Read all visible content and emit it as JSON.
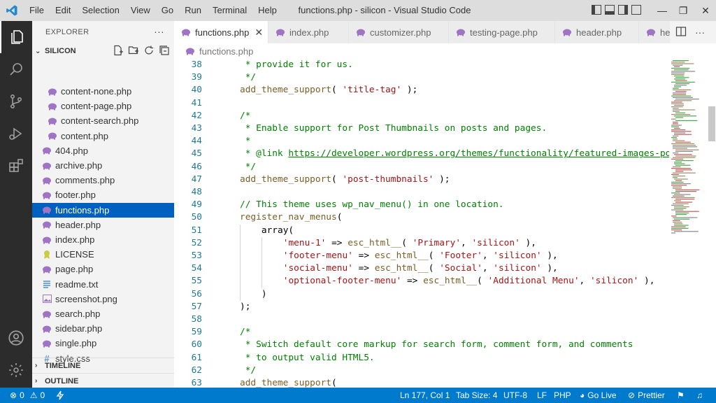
{
  "titlebar": {
    "menu": [
      "File",
      "Edit",
      "Selection",
      "View",
      "Go",
      "Run",
      "Terminal",
      "Help"
    ],
    "window_title": "functions.php - silicon - Visual Studio Code"
  },
  "sidebar": {
    "title": "EXPLORER",
    "more": "···",
    "folder": "SILICON",
    "files": [
      {
        "name": "content-none.php",
        "indent": 2,
        "icon": "php-elephant-icon"
      },
      {
        "name": "content-page.php",
        "indent": 2,
        "icon": "php-elephant-icon"
      },
      {
        "name": "content-search.php",
        "indent": 2,
        "icon": "php-elephant-icon"
      },
      {
        "name": "content.php",
        "indent": 2,
        "icon": "php-elephant-icon"
      },
      {
        "name": "404.php",
        "indent": 1,
        "icon": "php-elephant-icon"
      },
      {
        "name": "archive.php",
        "indent": 1,
        "icon": "php-elephant-icon"
      },
      {
        "name": "comments.php",
        "indent": 1,
        "icon": "php-elephant-icon"
      },
      {
        "name": "footer.php",
        "indent": 1,
        "icon": "php-elephant-icon"
      },
      {
        "name": "functions.php",
        "indent": 1,
        "icon": "php-elephant-icon",
        "active": true
      },
      {
        "name": "header.php",
        "indent": 1,
        "icon": "php-elephant-icon"
      },
      {
        "name": "index.php",
        "indent": 1,
        "icon": "php-elephant-icon"
      },
      {
        "name": "LICENSE",
        "indent": 1,
        "icon": "license-icon"
      },
      {
        "name": "page.php",
        "indent": 1,
        "icon": "php-elephant-icon"
      },
      {
        "name": "readme.txt",
        "indent": 1,
        "icon": "text-file-icon"
      },
      {
        "name": "screenshot.png",
        "indent": 1,
        "icon": "image-file-icon"
      },
      {
        "name": "search.php",
        "indent": 1,
        "icon": "php-elephant-icon"
      },
      {
        "name": "sidebar.php",
        "indent": 1,
        "icon": "php-elephant-icon"
      },
      {
        "name": "single.php",
        "indent": 1,
        "icon": "php-elephant-icon"
      },
      {
        "name": "style.css",
        "indent": 1,
        "icon": "css-hash-icon"
      }
    ],
    "timeline": "TIMELINE",
    "outline": "OUTLINE"
  },
  "tabs": [
    {
      "label": "functions.php",
      "active": true
    },
    {
      "label": "index.php"
    },
    {
      "label": "customizer.php"
    },
    {
      "label": "testing-page.php"
    },
    {
      "label": "header.php"
    },
    {
      "label": "hea"
    }
  ],
  "breadcrumb": "functions.php",
  "editor": {
    "lines": [
      {
        "n": "38",
        "indent": 1,
        "tokens": [
          [
            "comment",
            " * provide it for us."
          ]
        ]
      },
      {
        "n": "39",
        "indent": 1,
        "tokens": [
          [
            "comment",
            " */"
          ]
        ]
      },
      {
        "n": "40",
        "indent": 1,
        "tokens": [
          [
            "fn",
            "add_theme_support"
          ],
          [
            "plain",
            "( "
          ],
          [
            "string",
            "'title-tag'"
          ],
          [
            "plain",
            " );"
          ]
        ]
      },
      {
        "n": "41",
        "indent": 0,
        "tokens": []
      },
      {
        "n": "42",
        "indent": 1,
        "tokens": [
          [
            "comment",
            "/*"
          ]
        ]
      },
      {
        "n": "43",
        "indent": 1,
        "tokens": [
          [
            "comment",
            " * Enable support for Post Thumbnails on posts and pages."
          ]
        ]
      },
      {
        "n": "44",
        "indent": 1,
        "tokens": [
          [
            "comment",
            " *"
          ]
        ]
      },
      {
        "n": "45",
        "indent": 1,
        "tokens": [
          [
            "comment",
            " * @link "
          ],
          [
            "link",
            "https://developer.wordpress.org/themes/functionality/featured-images-post-thumbnails/"
          ]
        ]
      },
      {
        "n": "46",
        "indent": 1,
        "tokens": [
          [
            "comment",
            " */"
          ]
        ]
      },
      {
        "n": "47",
        "indent": 1,
        "tokens": [
          [
            "fn",
            "add_theme_support"
          ],
          [
            "plain",
            "( "
          ],
          [
            "string",
            "'post-thumbnails'"
          ],
          [
            "plain",
            " );"
          ]
        ]
      },
      {
        "n": "48",
        "indent": 0,
        "tokens": []
      },
      {
        "n": "49",
        "indent": 1,
        "tokens": [
          [
            "comment",
            "// This theme uses wp_nav_menu() in one location."
          ]
        ]
      },
      {
        "n": "50",
        "indent": 1,
        "tokens": [
          [
            "fn",
            "register_nav_menus"
          ],
          [
            "plain",
            "("
          ]
        ]
      },
      {
        "n": "51",
        "indent": 2,
        "tokens": [
          [
            "plain",
            "array("
          ]
        ]
      },
      {
        "n": "52",
        "indent": 3,
        "tokens": [
          [
            "string",
            "'menu-1'"
          ],
          [
            "plain",
            " => "
          ],
          [
            "fn",
            "esc_html__"
          ],
          [
            "plain",
            "( "
          ],
          [
            "string",
            "'Primary'"
          ],
          [
            "plain",
            ", "
          ],
          [
            "string",
            "'silicon'"
          ],
          [
            "plain",
            " ),"
          ]
        ]
      },
      {
        "n": "53",
        "indent": 3,
        "tokens": [
          [
            "string",
            "'footer-menu'"
          ],
          [
            "plain",
            " => "
          ],
          [
            "fn",
            "esc_html__"
          ],
          [
            "plain",
            "( "
          ],
          [
            "string",
            "'Footer'"
          ],
          [
            "plain",
            ", "
          ],
          [
            "string",
            "'silicon'"
          ],
          [
            "plain",
            " ),"
          ]
        ]
      },
      {
        "n": "54",
        "indent": 3,
        "tokens": [
          [
            "string",
            "'social-menu'"
          ],
          [
            "plain",
            " => "
          ],
          [
            "fn",
            "esc_html__"
          ],
          [
            "plain",
            "( "
          ],
          [
            "string",
            "'Social'"
          ],
          [
            "plain",
            ", "
          ],
          [
            "string",
            "'silicon'"
          ],
          [
            "plain",
            " ),"
          ]
        ]
      },
      {
        "n": "55",
        "indent": 3,
        "tokens": [
          [
            "string",
            "'optional-footer-menu'"
          ],
          [
            "plain",
            " => "
          ],
          [
            "fn",
            "esc_html__"
          ],
          [
            "plain",
            "( "
          ],
          [
            "string",
            "'Additional Menu'"
          ],
          [
            "plain",
            ", "
          ],
          [
            "string",
            "'silicon'"
          ],
          [
            "plain",
            " ),"
          ]
        ]
      },
      {
        "n": "56",
        "indent": 2,
        "tokens": [
          [
            "plain",
            ")"
          ]
        ]
      },
      {
        "n": "57",
        "indent": 1,
        "tokens": [
          [
            "plain",
            ");"
          ]
        ]
      },
      {
        "n": "58",
        "indent": 0,
        "tokens": []
      },
      {
        "n": "59",
        "indent": 1,
        "tokens": [
          [
            "comment",
            "/*"
          ]
        ]
      },
      {
        "n": "60",
        "indent": 1,
        "tokens": [
          [
            "comment",
            " * Switch default core markup for search form, comment form, and comments"
          ]
        ]
      },
      {
        "n": "61",
        "indent": 1,
        "tokens": [
          [
            "comment",
            " * to output valid HTML5."
          ]
        ]
      },
      {
        "n": "62",
        "indent": 1,
        "tokens": [
          [
            "comment",
            " */"
          ]
        ]
      },
      {
        "n": "63",
        "indent": 1,
        "tokens": [
          [
            "fn",
            "add_theme_support"
          ],
          [
            "plain",
            "("
          ]
        ]
      }
    ]
  },
  "statusbar": {
    "errors": "0",
    "warnings": "0",
    "position": "Ln 177, Col 1",
    "tab_size": "Tab Size: 4",
    "encoding": "UTF-8",
    "eol": "LF",
    "language": "PHP",
    "go_live": "Go Live",
    "prettier": "Prettier"
  },
  "colors": {
    "accent": "#007acc",
    "selection": "#0060c0",
    "comment": "#008000",
    "string": "#a31515",
    "function": "#795e26",
    "php_icon": "#a074c4"
  }
}
